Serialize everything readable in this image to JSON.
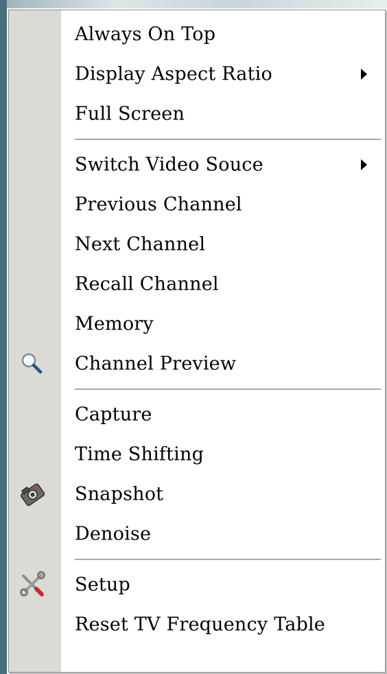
{
  "context_menu": {
    "groups": [
      {
        "items": [
          {
            "label": "Always On Top",
            "submenu": false,
            "icon": null
          },
          {
            "label": "Display Aspect Ratio",
            "submenu": true,
            "icon": null
          },
          {
            "label": "Full Screen",
            "submenu": false,
            "icon": null
          }
        ]
      },
      {
        "items": [
          {
            "label": "Switch Video Souce",
            "submenu": true,
            "icon": null
          },
          {
            "label": "Previous Channel",
            "submenu": false,
            "icon": null
          },
          {
            "label": "Next Channel",
            "submenu": false,
            "icon": null
          },
          {
            "label": "Recall Channel",
            "submenu": false,
            "icon": null
          },
          {
            "label": "Memory",
            "submenu": false,
            "icon": null
          },
          {
            "label": "Channel Preview",
            "submenu": false,
            "icon": "magnifier-icon"
          }
        ]
      },
      {
        "items": [
          {
            "label": "Capture",
            "submenu": false,
            "icon": null
          },
          {
            "label": "Time Shifting",
            "submenu": false,
            "icon": null
          },
          {
            "label": "Snapshot",
            "submenu": false,
            "icon": "camera-icon"
          },
          {
            "label": "Denoise",
            "submenu": false,
            "icon": null
          }
        ]
      },
      {
        "items": [
          {
            "label": "Setup",
            "submenu": false,
            "icon": "tools-icon"
          },
          {
            "label": "Reset TV Frequency Table",
            "submenu": false,
            "icon": null
          }
        ]
      }
    ]
  }
}
